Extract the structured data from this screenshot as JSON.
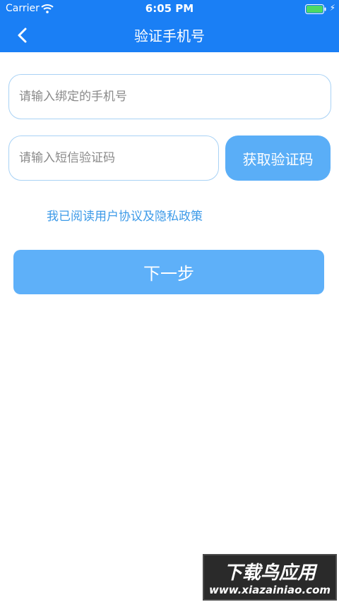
{
  "status_bar": {
    "carrier": "Carrier",
    "time": "6:05 PM",
    "icons": [
      "wifi-icon",
      "battery-icon",
      "charging-bolt-icon"
    ]
  },
  "nav": {
    "back_icon": "chevron-left-icon",
    "title": "验证手机号"
  },
  "form": {
    "phone_placeholder": "请输入绑定的手机号",
    "code_placeholder": "请输入短信验证码",
    "get_code_label": "获取验证码",
    "agreement_text": "我已阅读用户协议及隐私政策",
    "next_label": "下一步"
  },
  "watermark": {
    "title": "下载鸟应用",
    "url": "www.xiazainiao.com"
  },
  "colors": {
    "header": "#1a7ff5",
    "button": "#5aaef7",
    "link": "#3c9ae8",
    "input_border": "#a9d2f5",
    "battery": "#4cd964"
  }
}
